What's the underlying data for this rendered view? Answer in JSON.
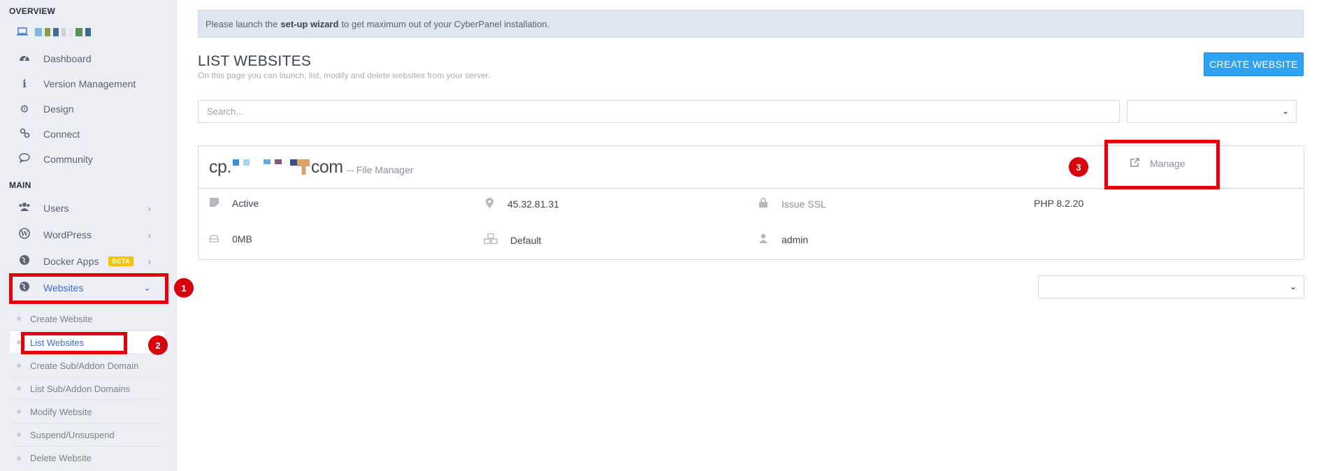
{
  "sidebar": {
    "overview_title": "OVERVIEW",
    "main_title": "MAIN",
    "overview_items": [
      {
        "label": "Dashboard",
        "icon": "dashboard-icon"
      },
      {
        "label": "Version Management",
        "icon": "info-icon"
      },
      {
        "label": "Design",
        "icon": "gear-icon"
      },
      {
        "label": "Connect",
        "icon": "link-icon"
      },
      {
        "label": "Community",
        "icon": "chat-icon"
      }
    ],
    "main_items": [
      {
        "label": "Users",
        "icon": "users-icon"
      },
      {
        "label": "WordPress",
        "icon": "wordpress-icon"
      },
      {
        "label": "Docker Apps",
        "icon": "globe-icon",
        "badge": "BETA"
      },
      {
        "label": "Websites",
        "icon": "globe-icon"
      }
    ],
    "website_subitems": [
      "Create Website",
      "List Websites",
      "Create Sub/Addon Domain",
      "List Sub/Addon Domains",
      "Modify Website",
      "Suspend/Unsuspend",
      "Delete Website"
    ]
  },
  "annotations": [
    "1",
    "2",
    "3"
  ],
  "alert": {
    "prefix": "Please launch the",
    "link": "set-up wizard",
    "suffix": "to get maximum out of your CyberPanel installation."
  },
  "header": {
    "title": "LIST WEBSITES",
    "subtitle": "On this page you can launch, list, modify and delete websites from your server.",
    "create_button": "CREATE WEBSITE"
  },
  "search": {
    "placeholder": "Search..."
  },
  "website": {
    "domain_prefix": "cp.",
    "domain_suffix": "com",
    "file_manager": "-- File Manager",
    "manage_label": "Manage",
    "status": "Active",
    "ip": "45.32.81.31",
    "ssl": "Issue SSL",
    "php": "PHP 8.2.20",
    "disk": "0MB",
    "package": "Default",
    "owner": "admin"
  },
  "colors": {
    "accent": "#2fa3f2",
    "active_link": "#3a6fd1",
    "highlight": "#e6000a",
    "beta_badge": "#f5c400"
  }
}
